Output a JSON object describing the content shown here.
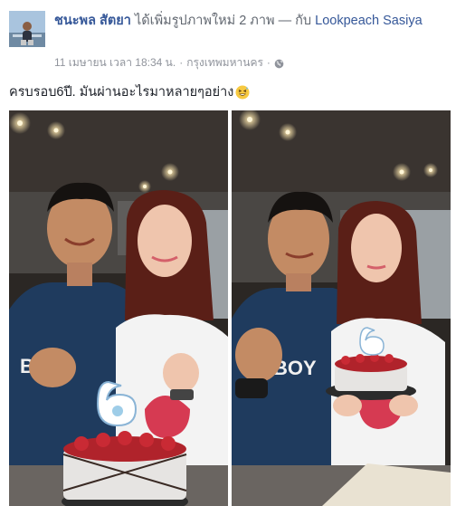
{
  "post": {
    "author_name": "ชนะพล สัตยา",
    "action_text": "ได้เพิ่มรูปภาพใหม่ 2 ภาพ — กับ",
    "tagged_name": "Lookpeach Sasiya",
    "timestamp": "11 เมษายน เวลา 18:34 น.",
    "separator": "·",
    "location": "กรุงเทพมหานคร",
    "separator2": "·",
    "privacy_icon": "globe-icon",
    "caption": "ครบรอบ6ปี. มันผ่านอะไรมาหลายๆอย่าง",
    "caption_emoji": "grinning-sweat-emoji"
  },
  "photos": [
    {
      "id": "photo-1",
      "cake_candle": "6"
    },
    {
      "id": "photo-2",
      "cake_candle": "6"
    }
  ],
  "colors": {
    "link_blue": "#365899",
    "meta_gray": "#90949c",
    "text_dark": "#1d2129"
  }
}
